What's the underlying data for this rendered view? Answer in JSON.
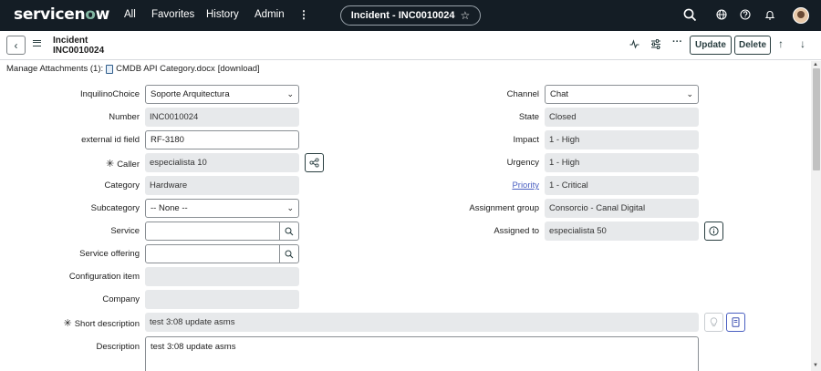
{
  "nav": {
    "logo_text": "servicen",
    "logo_o": "o",
    "logo_end": "w",
    "links": [
      "All",
      "Favorites",
      "History",
      "Admin"
    ],
    "more_icon": "vertical-dots-icon",
    "record_pill": "Incident - INC0010024",
    "star": "☆",
    "icons": [
      "search-icon",
      "globe-icon",
      "help-icon",
      "bell-icon",
      "avatar"
    ]
  },
  "header": {
    "record_type": "Incident",
    "record_number": "INC0010024",
    "update_label": "Update",
    "delete_label": "Delete",
    "icons": [
      "back-icon",
      "menu-icon",
      "activity-icon",
      "settings-sliders-icon",
      "more-icon",
      "up-arrow-icon",
      "down-arrow-icon"
    ]
  },
  "attachments": {
    "label": "Manage Attachments (1):",
    "file": "CMDB API Category.docx",
    "download": "[download]"
  },
  "form": {
    "inquilino_label": "InquilinoChoice",
    "inquilino_value": "Soporte Arquitectura",
    "number_label": "Number",
    "number_value": "INC0010024",
    "external_id_label": "external id field",
    "external_id_value": "RF-3180",
    "caller_label": "Caller",
    "caller_value": "especialista 10",
    "category_label": "Category",
    "category_value": "Hardware",
    "subcategory_label": "Subcategory",
    "subcategory_value": "-- None --",
    "service_label": "Service",
    "service_value": "",
    "service_offering_label": "Service offering",
    "service_offering_value": "",
    "ci_label": "Configuration item",
    "ci_value": "",
    "company_label": "Company",
    "company_value": "",
    "short_desc_label": "Short description",
    "short_desc_value": "test 3:08 update asms",
    "description_label": "Description",
    "description_value": "test 3:08 update asms",
    "channel_label": "Channel",
    "channel_value": "Chat",
    "state_label": "State",
    "state_value": "Closed",
    "impact_label": "Impact",
    "impact_value": "1 - High",
    "urgency_label": "Urgency",
    "urgency_value": "1 - High",
    "priority_label": "Priority",
    "priority_value": "1 - Critical",
    "assignment_group_label": "Assignment group",
    "assignment_group_value": "Consorcio - Canal Digital",
    "assigned_to_label": "Assigned to",
    "assigned_to_value": "especialista 50",
    "required_mark": "✳"
  },
  "colors": {
    "nav_bg": "#141d25",
    "logo_accent": "#81b5a1",
    "readonly_bg": "#e7e9eb",
    "link": "#4a5fc1"
  }
}
